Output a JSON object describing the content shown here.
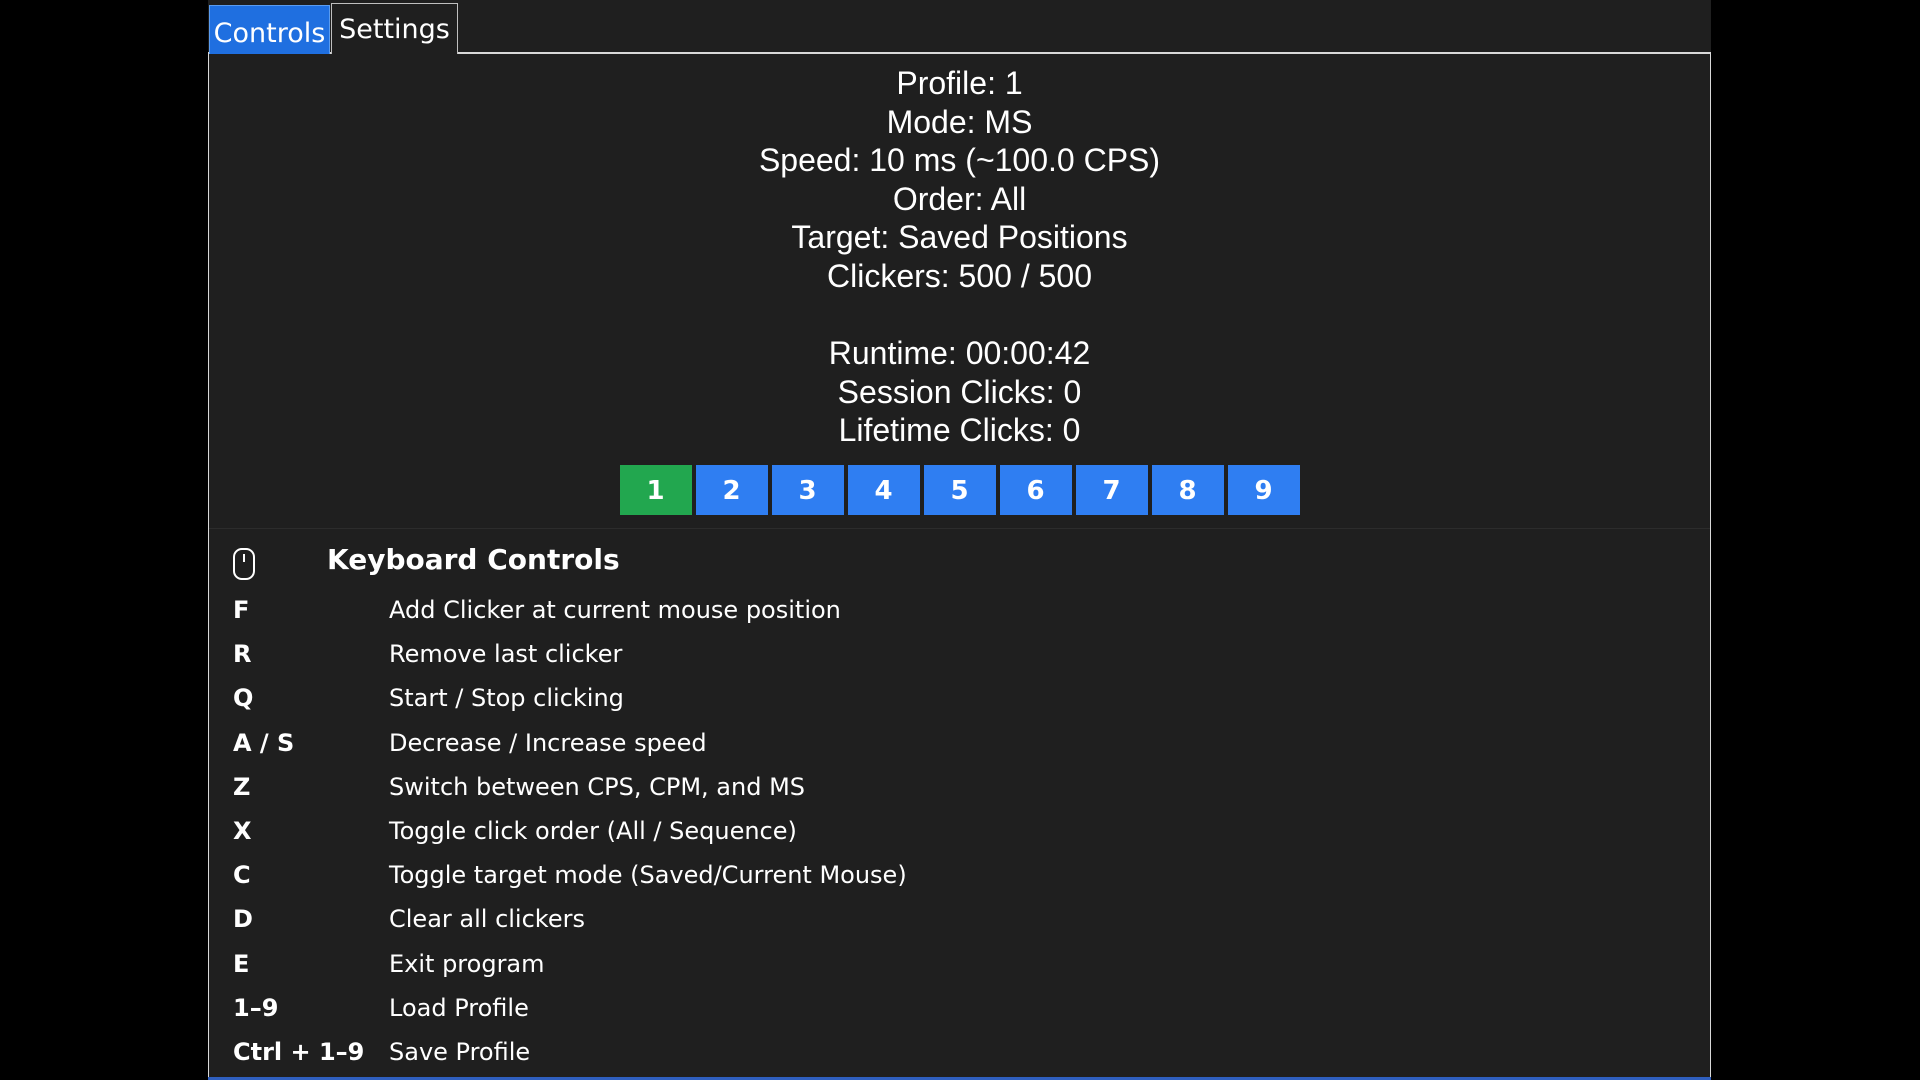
{
  "tabs": {
    "controls": "Controls",
    "settings": "Settings"
  },
  "status": {
    "profile": "Profile: 1",
    "mode": "Mode: MS",
    "speed": "Speed: 10 ms (~100.0 CPS)",
    "order": "Order: All",
    "target": "Target: Saved Positions",
    "clickers": "Clickers: 500 / 500",
    "runtime": "Runtime: 00:00:42",
    "session_clicks": "Session Clicks: 0",
    "lifetime_clicks": "Lifetime Clicks: 0"
  },
  "profiles": {
    "active": "1",
    "items": [
      "1",
      "2",
      "3",
      "4",
      "5",
      "6",
      "7",
      "8",
      "9"
    ],
    "active_color": "#22a74f",
    "inactive_color": "#2f7ef2"
  },
  "keyboard": {
    "icon": "mouse-icon",
    "title": "Keyboard Controls",
    "rows": [
      {
        "key": "F",
        "desc": "Add Clicker at current mouse position"
      },
      {
        "key": "R",
        "desc": "Remove last clicker"
      },
      {
        "key": "Q",
        "desc": "Start / Stop clicking"
      },
      {
        "key": "A / S",
        "desc": "Decrease / Increase speed"
      },
      {
        "key": "Z",
        "desc": "Switch between CPS, CPM, and MS"
      },
      {
        "key": "X",
        "desc": "Toggle click order (All / Sequence)"
      },
      {
        "key": "C",
        "desc": "Toggle target mode (Saved/Current Mouse)"
      },
      {
        "key": "D",
        "desc": "Clear all clickers"
      },
      {
        "key": "E",
        "desc": "Exit program"
      },
      {
        "key": "1–9",
        "desc": "Load Profile"
      },
      {
        "key": "Ctrl + 1–9",
        "desc": "Save Profile"
      }
    ]
  },
  "colors": {
    "accent": "#1f6fe0",
    "background": "#1f1f1f"
  }
}
